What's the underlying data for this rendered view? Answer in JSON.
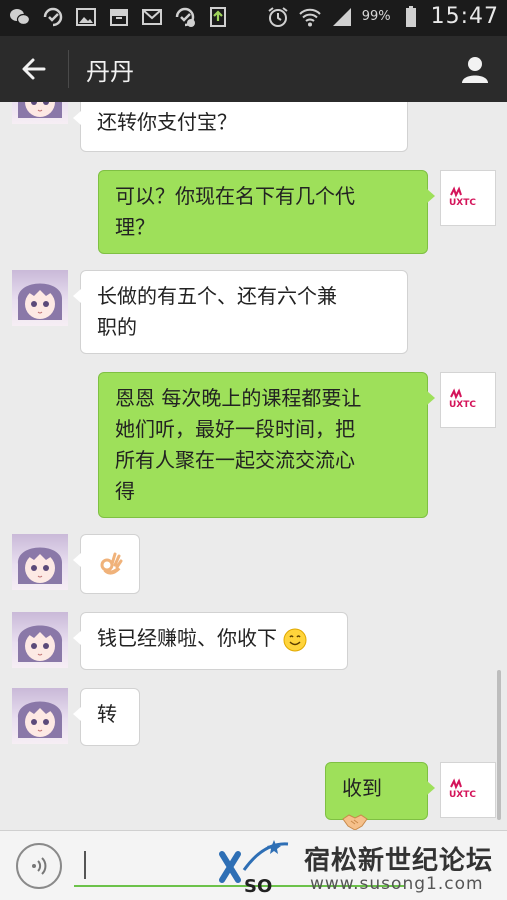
{
  "status_bar": {
    "icons": [
      "wechat-icon",
      "check-refresh-icon",
      "gallery-icon",
      "archive-icon",
      "mail-icon",
      "check-sync-icon",
      "upload-icon",
      "alarm-icon",
      "wifi-icon",
      "signal-icon"
    ],
    "battery": "99%",
    "time": "15:47"
  },
  "header": {
    "title": "丹丹",
    "back_icon": "back-arrow-icon",
    "profile_icon": "person-icon"
  },
  "messages": [
    {
      "sender": "other",
      "text": "还转你支付宝？"
    },
    {
      "sender": "me",
      "lines": [
        "可以？你现在名下有几个代",
        "理？"
      ]
    },
    {
      "sender": "other",
      "lines": [
        "长做的有五个、还有六个兼",
        "职的"
      ]
    },
    {
      "sender": "me",
      "lines": [
        "恩恩 每次晚上的课程都要让",
        "她们听，最好一段时间，把",
        "所有人聚在一起交流交流心",
        "得"
      ]
    },
    {
      "sender": "other",
      "emoji": "ok-hand-emoji"
    },
    {
      "sender": "other",
      "text": "钱已经赚啦、你收下",
      "emoji": "smile-emoji"
    },
    {
      "sender": "other",
      "text": "转"
    },
    {
      "sender": "me",
      "text": "收到",
      "emoji": "handshake-emoji"
    }
  ],
  "me_avatar_logo": "UXTC",
  "input": {
    "voice_icon": "voice-icon",
    "plus_icon": "plus-icon",
    "value": ""
  },
  "watermark": {
    "title": "宿松新世纪论坛",
    "url": "www.susong1.com",
    "logo_text": "SO"
  },
  "colors": {
    "sent_bubble": "#9ee05a",
    "received_bubble": "#ffffff",
    "header_bg": "#2b2b2b",
    "background": "#ebebeb"
  }
}
